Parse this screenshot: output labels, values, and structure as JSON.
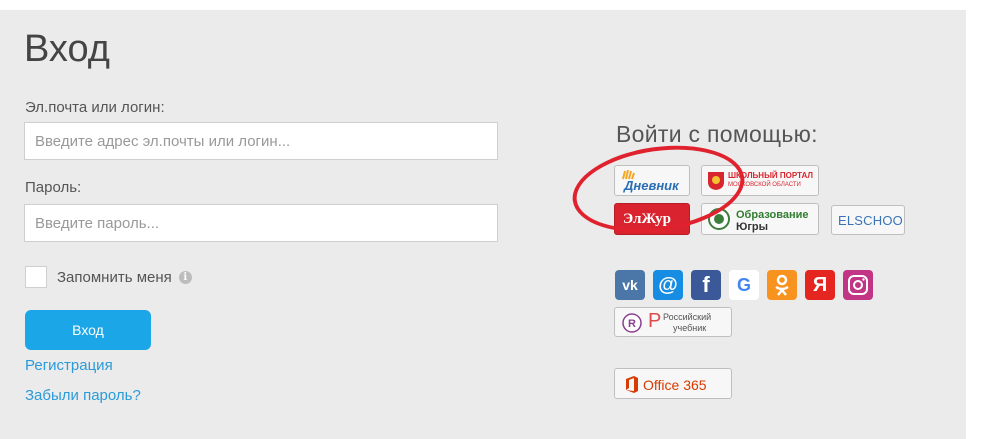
{
  "form": {
    "title": "Вход",
    "login_label": "Эл.почта или логин:",
    "login_placeholder": "Введите адрес эл.почты или логин...",
    "password_label": "Пароль:",
    "password_placeholder": "Введите пароль...",
    "remember_label": "Запомнить меня",
    "info_icon_glyph": "i",
    "submit_label": "Вход",
    "register_link": "Регистрация",
    "forgot_link": "Забыли пароль?"
  },
  "social": {
    "title": "Войти с помощью:",
    "dnevnik": "Дневник",
    "school_portal_line1": "ШКОЛЬНЫЙ ПОРТАЛ",
    "school_portal_line2": "МОСКОВСКОЙ ОБЛАСТИ",
    "eljur": "ЭлЖур",
    "ugra_line1": "Образование",
    "ugra_line2": "Югры",
    "elschool": "ELSCHOOL",
    "vk": "vk",
    "mail": "@",
    "facebook": "f",
    "google": "G",
    "ok": "ok",
    "yandex": "Я",
    "instagram": "instagram",
    "rus_textbook_line1": "Российский",
    "rus_textbook_line2": "учебник",
    "rus_textbook_letter": "Р",
    "office": "Office 365"
  },
  "colors": {
    "accent": "#1aa6e7",
    "link": "#2a9bd9",
    "highlight": "#e0222e",
    "vk": "#4a76a8",
    "mail": "#168de2",
    "facebook": "#3b5998",
    "google_bg": "#ffffff",
    "ok": "#f7931e",
    "yandex": "#e52620",
    "instagram": "#c13584",
    "office": "#d83b01"
  }
}
